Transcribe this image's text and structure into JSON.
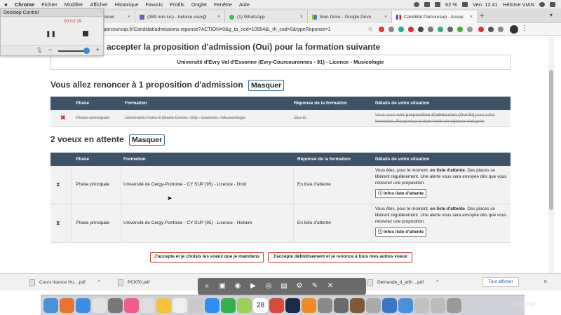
{
  "menubar": {
    "apple": "",
    "items": [
      "Chrome",
      "Fichier",
      "Modifier",
      "Afficher",
      "Historique",
      "Favoris",
      "Profils",
      "Onglet",
      "Fenêtre",
      "Aide"
    ],
    "battery": "62 %",
    "clock": "Ven. 12:41",
    "user": "Héloïse VIAN"
  },
  "tabs": [
    {
      "label": "onnel"
    },
    {
      "label": "(389 non lus) - heloise.vian@"
    },
    {
      "label": "(1) WhatsApp"
    },
    {
      "label": "Mon Drive - Google Drive"
    },
    {
      "label": "Candidat Parcoursup - Accep"
    }
  ],
  "toolbar": {
    "url": "el.parcoursup.fr/Candidat/admissions.reponse?ACTION=0&g_ta_cod=10954&i_rh_cod=0&typeReponse=1"
  },
  "desktop_control": {
    "title": "Desktop Control",
    "time": "00:02:19",
    "volume_percent": 95
  },
  "page": {
    "accept_heading": "accepter la proposition d'admission (Oui) pour la formation suivante",
    "univ": "Université d'Evry Val d'Essonne (Evry-Courcouronnes - 91) - Licence - Musicologie",
    "renounce_title": "Vous allez renoncer à 1 proposition d'admission",
    "waiting_title": "2 voeux en attente",
    "masquer": "Masquer",
    "renounce_headers": [
      "Phase",
      "Formation",
      "Réponse de la formation",
      "Détails de votre situation"
    ],
    "renounce_row": {
      "phase": "Phase principale",
      "formation": "Université Paris 8 (Saint-Denis - 93) - Licence - Musicologie",
      "reponse": "Oui-Si",
      "details_pre": "Vous avez ",
      "details_bold": "une proposition d'admission (Oui-Si)",
      "details_post": " pour cette formation. Respectez la date limite de réponse indiquée"
    },
    "waiting_headers": [
      "Phase",
      "Formation",
      "Réponse de la formation",
      "Détails de votre situation"
    ],
    "waiting_rows": [
      {
        "phase": "Phase principale",
        "formation": "Université de Cergy-Pontoise - CY SUP (95) - Licence - Droit",
        "reponse": "En liste d'attente",
        "details_pre": "Vous êtes, pour le moment, ",
        "details_bold": "en liste d'attente",
        "details_post": ". Des places se libèrent régulièrement. Une alerte vous sera envoyée dès que vous recevrez une proposition.",
        "infos": "Infos liste d'attente"
      },
      {
        "phase": "Phase principale",
        "formation": "Université de Cergy-Pontoise - CY SUP (95) - Licence - Histoire",
        "reponse": "En liste d'attente",
        "details_pre": "Vous êtes, pour le moment, ",
        "details_bold": "en liste d'attente",
        "details_post": ". Des places se libèrent régulièrement. Une alerte vous sera envoyée dès que vous recevrez une proposition.",
        "infos": "Infos liste d'attente"
      }
    ],
    "btn_keep": "J'accepte et je choisis les voeux que je maintiens",
    "btn_renounce": "J'accepte définitivement et je renonce à tous mes autres voeux"
  },
  "downloads": [
    {
      "name": "Cours licence Hu....pdf"
    },
    {
      "name": "PCK50.pdf"
    },
    {
      "name": "Demande_d_adh....pdf"
    }
  ],
  "tout_afficher": "Tout afficher",
  "watermark": "yting.com",
  "dock_date": "28"
}
